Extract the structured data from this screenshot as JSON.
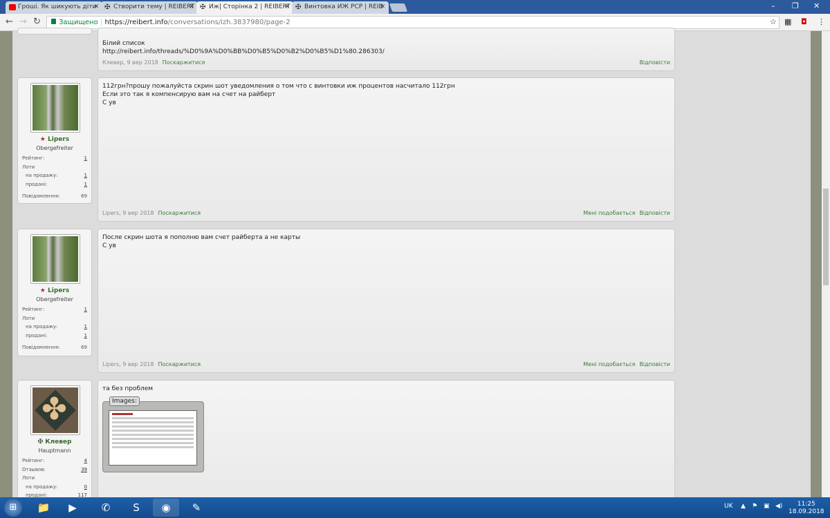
{
  "browser": {
    "tabs": [
      {
        "label": "Гроші. Як шикують діти",
        "icon": "youtube-icon",
        "active": false
      },
      {
        "label": "Створити тему | REIBERT",
        "icon": "cross-icon",
        "active": false
      },
      {
        "label": "Иж| Сторінка 2 | REIBERT",
        "icon": "cross-icon",
        "active": true
      },
      {
        "label": "Винтовка ИЖ РСР | REIB",
        "icon": "cross-icon",
        "active": false
      }
    ],
    "tab_close": "✕",
    "security_label": "Защищено",
    "url_host": "https://reibert.info",
    "url_path": "/conversations/izh.3837980/page-2"
  },
  "posts": [
    {
      "lines": [
        "Білий список",
        "http://reibert.info/threads/%D0%9A%D0%BB%D0%B5%D0%B2%D0%B5%D1%80.286303/"
      ],
      "meta": "Клевер, 9 вер 2018",
      "report": "Поскаржитися",
      "reply": "Відповісти"
    },
    {
      "user": {
        "name": "Lipers",
        "title": "Obergefreiter",
        "rating_label": "Рейтинг:",
        "rating": "1",
        "lots_label": "Лоти",
        "for_sale_label": "на продажу:",
        "for_sale": "1",
        "sold_label": "продані:",
        "sold": "1",
        "messages_label": "Повідомлення:",
        "messages": "69"
      },
      "lines": [
        "112грн?прошу пожалуйста скрин шот уведомления о том что с винтовки иж процентов насчитало 112грн",
        "Если это так я компенсирую вам на счет на райберт",
        "С ув"
      ],
      "meta": "Lipers, 9 вер 2018",
      "report": "Поскаржитися",
      "like": "Мені подобається",
      "reply": "Відповісти"
    },
    {
      "user": {
        "name": "Lipers",
        "title": "Obergefreiter",
        "rating_label": "Рейтинг:",
        "rating": "1",
        "lots_label": "Лоти",
        "for_sale_label": "на продажу:",
        "for_sale": "1",
        "sold_label": "продані:",
        "sold": "1",
        "messages_label": "Повідомлення:",
        "messages": "69"
      },
      "lines": [
        "После скрин шота я пополню вам счет райберта а не карты",
        "С ув"
      ],
      "meta": "Lipers, 9 вер 2018",
      "report": "Поскаржитися",
      "like": "Мені подобається",
      "reply": "Відповісти"
    },
    {
      "user": {
        "name": "Клевер",
        "title": "Hauptmann",
        "rating_label": "Рейтинг:",
        "rating": "4",
        "reviews_label": "Отзывов:",
        "reviews": "39",
        "lots_label": "Лоти",
        "for_sale_label": "на продажу:",
        "for_sale": "0",
        "sold_label": "продані:",
        "sold": "117"
      },
      "lines": [
        "та без проблем"
      ],
      "images_label": "Images:"
    }
  ],
  "taskbar": {
    "lang": "UK",
    "time": "11:25",
    "date": "18.09.2018"
  }
}
